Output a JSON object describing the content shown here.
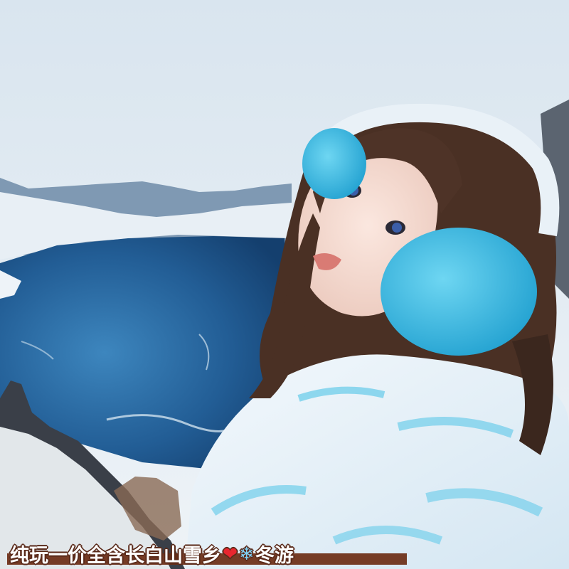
{
  "caption": {
    "text_main": "纯玩一价全含长白山雪乡",
    "heart_glyph": "❤",
    "snowflake_glyph": "❄",
    "text_end": "冬游"
  },
  "colors": {
    "sky": "#e4ecf3",
    "lake": "#2a6aa3",
    "snow": "#f4f8fb",
    "fur_blue": "#3fc0e6",
    "hair": "#4a3024",
    "caption_bar": "#6b2d14"
  }
}
